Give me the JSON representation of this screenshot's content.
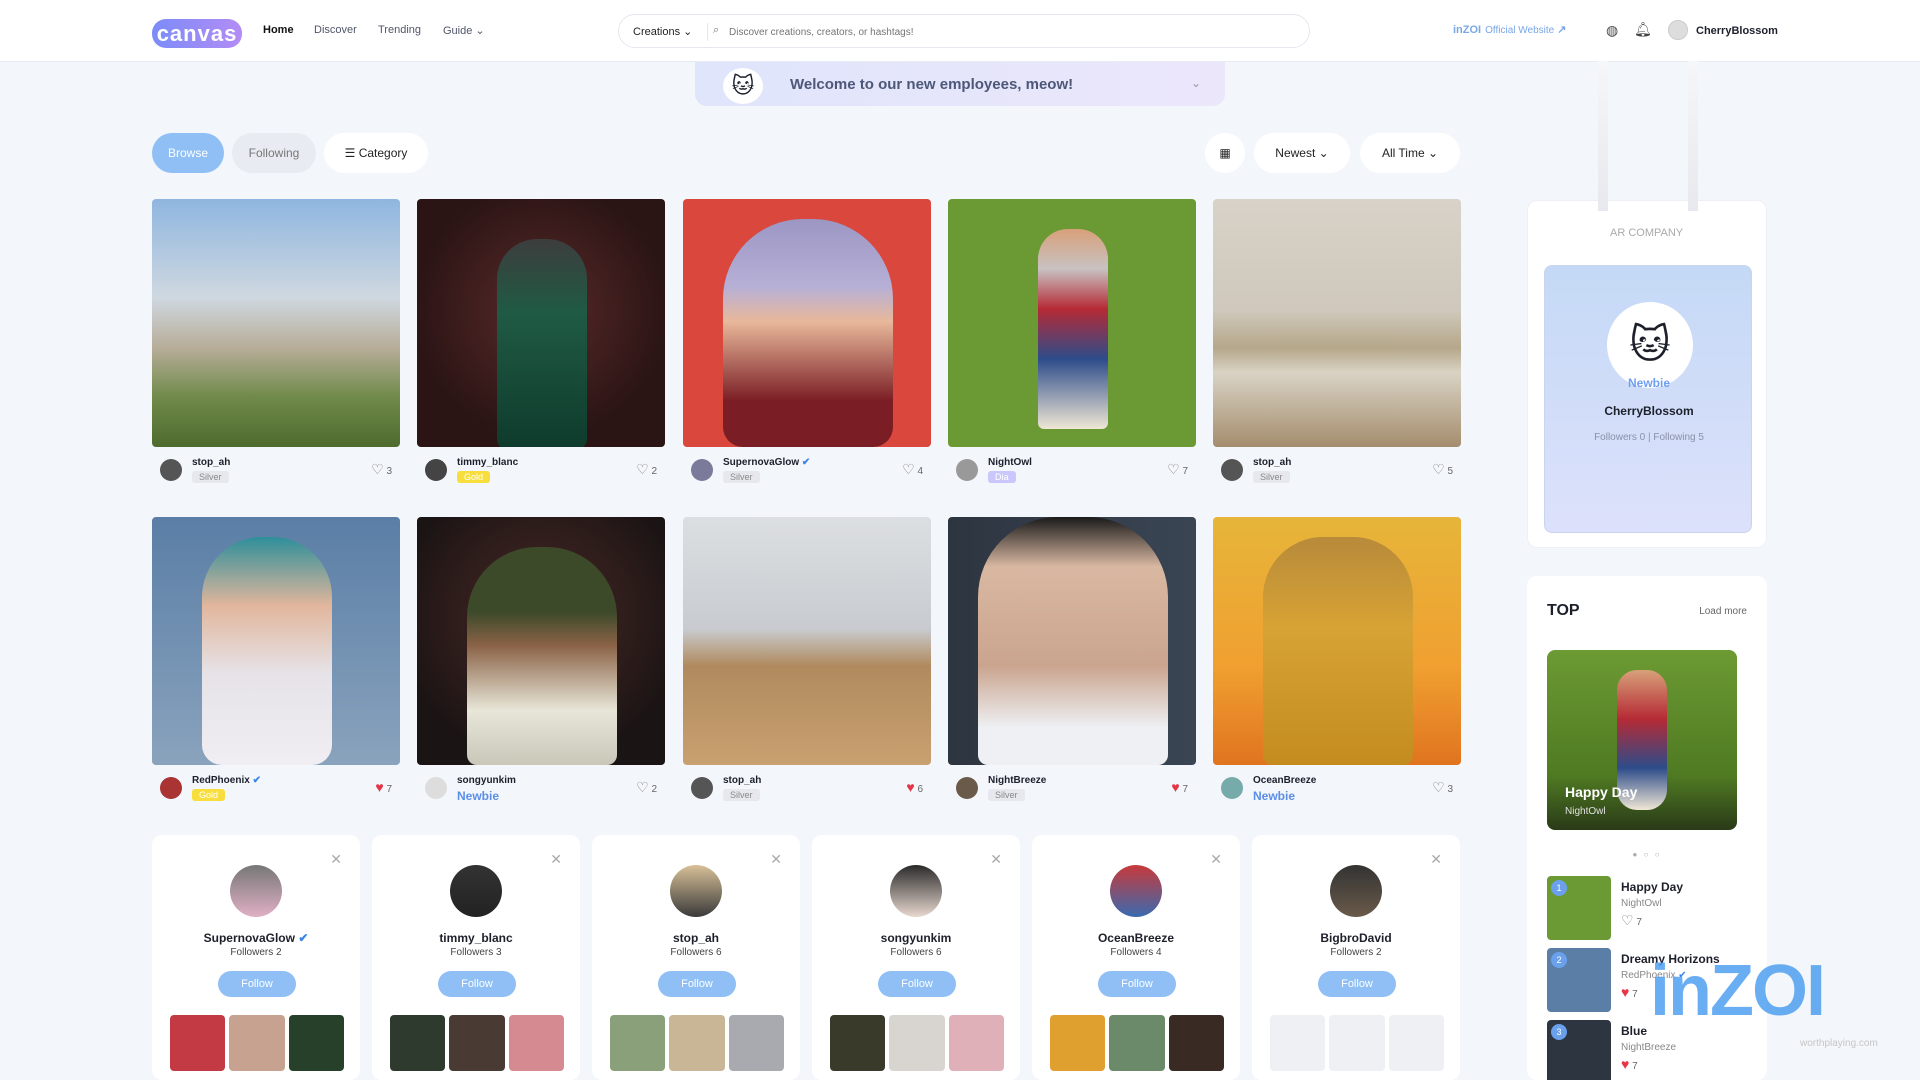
{
  "header": {
    "logo": "canvas",
    "nav": [
      "Home",
      "Discover",
      "Trending",
      "Guide"
    ],
    "search_select": "Creations",
    "search_placeholder": "Discover creations, creators, or hashtags!",
    "brand": "inZOI",
    "brand_link": "Official Website",
    "username": "CherryBlossom"
  },
  "banner": {
    "text": "Welcome to our new employees, meow!"
  },
  "toolbar": {
    "browse": "Browse",
    "following": "Following",
    "category": "Category",
    "sort": "Newest",
    "time": "All Time"
  },
  "creations": [
    {
      "user": "stop_ah",
      "badge": "Silver",
      "likes": "3",
      "liked": false
    },
    {
      "user": "timmy_blanc",
      "badge": "Gold",
      "likes": "2",
      "liked": false
    },
    {
      "user": "SupernovaGlow",
      "badge": "Silver",
      "likes": "4",
      "liked": false
    },
    {
      "user": "NightOwl",
      "badge": "Dia",
      "likes": "7",
      "liked": false
    },
    {
      "user": "stop_ah",
      "badge": "Silver",
      "likes": "5",
      "liked": false
    },
    {
      "user": "RedPhoenix",
      "badge": "Gold",
      "likes": "7",
      "liked": true
    },
    {
      "user": "songyunkim",
      "badge": "Newbie",
      "likes": "2",
      "liked": false
    },
    {
      "user": "stop_ah",
      "badge": "Silver",
      "likes": "6",
      "liked": true
    },
    {
      "user": "NightBreeze",
      "badge": "Silver",
      "likes": "7",
      "liked": true
    },
    {
      "user": "OceanBreeze",
      "badge": "Newbie",
      "likes": "3",
      "liked": false
    }
  ],
  "suggested": [
    {
      "name": "SupernovaGlow",
      "followers": "Followers 2",
      "button": "Follow"
    },
    {
      "name": "timmy_blanc",
      "followers": "Followers 3",
      "button": "Follow"
    },
    {
      "name": "stop_ah",
      "followers": "Followers 6",
      "button": "Follow"
    },
    {
      "name": "songyunkim",
      "followers": "Followers 6",
      "button": "Follow"
    },
    {
      "name": "OceanBreeze",
      "followers": "Followers 4",
      "button": "Follow"
    },
    {
      "name": "BigbroDavid",
      "followers": "Followers 2",
      "button": "Follow"
    }
  ],
  "profile": {
    "company": "AR COMPANY",
    "tier": "Newbie",
    "name": "CherryBlossom",
    "stats": "Followers  0  |  Following  5"
  },
  "top": {
    "title": "TOP",
    "load_more": "Load more",
    "hero_title": "Happy Day",
    "hero_author": "NightOwl",
    "items": [
      {
        "rank": "1",
        "title": "Happy Day",
        "author": "NightOwl",
        "likes": "7"
      },
      {
        "rank": "2",
        "title": "Dreamy Horizons",
        "author": "RedPhoenix",
        "likes": "7"
      },
      {
        "rank": "3",
        "title": "Blue",
        "author": "NightBreeze",
        "likes": "7"
      }
    ]
  },
  "watermark": "inZOI",
  "watermark_site": "worthplaying.com"
}
